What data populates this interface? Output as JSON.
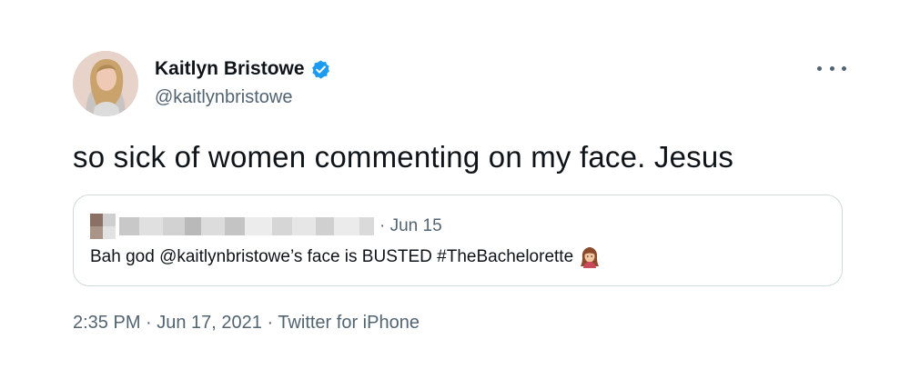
{
  "author": {
    "display_name": "Kaitlyn Bristowe",
    "handle": "@kaitlynbristowe",
    "verified": true
  },
  "tweet": {
    "text": "so sick of women commenting on my face. Jesus"
  },
  "quoted_tweet": {
    "date": "· Jun 15",
    "text": "Bah god @kaitlynbristowe’s face is BUSTED #TheBachelorette"
  },
  "meta": {
    "text": "2:35 PM · Jun 17, 2021 · Twitter for iPhone"
  },
  "colors": {
    "text_primary": "#0f1419",
    "text_secondary": "#536471",
    "verified_blue": "#1d9bf0",
    "border": "#cfd9de"
  },
  "icons": {
    "verified": "verified-badge-icon",
    "more": "more-options-icon",
    "emoji": "woman-emoji-icon"
  }
}
